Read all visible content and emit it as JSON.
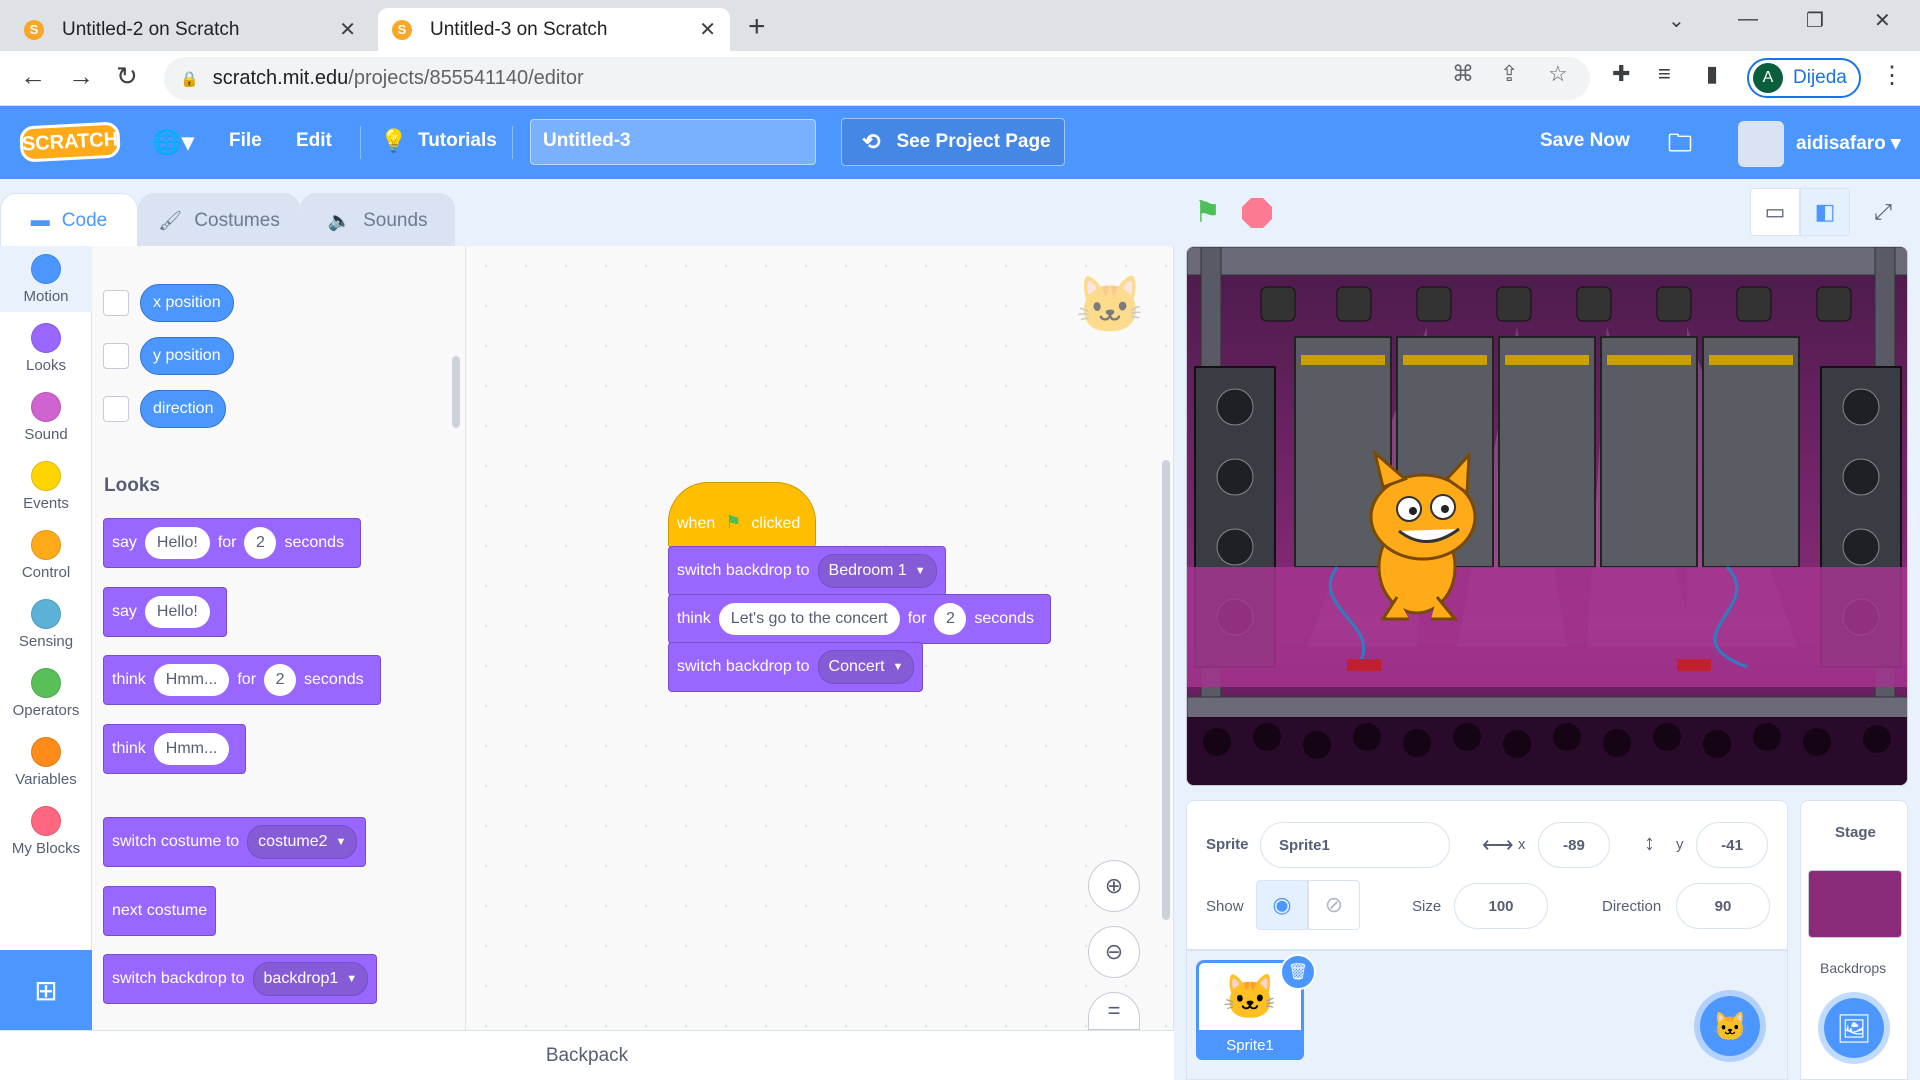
{
  "browser": {
    "tabs": [
      {
        "title": "Untitled-2 on Scratch",
        "active": false
      },
      {
        "title": "Untitled-3 on Scratch",
        "active": true
      }
    ],
    "url_host": "scratch.mit.edu",
    "url_path": "/projects/855541140/editor",
    "profile_initial": "A",
    "profile_name": "Dijeda"
  },
  "menubar": {
    "logo": "SCRATCH",
    "file": "File",
    "edit": "Edit",
    "tutorials": "Tutorials",
    "project_title": "Untitled-3",
    "see_project_page": "See Project Page",
    "save_now": "Save Now",
    "username": "aidisafaro"
  },
  "editor_tabs": {
    "code": "Code",
    "costumes": "Costumes",
    "sounds": "Sounds"
  },
  "categories": [
    {
      "name": "Motion",
      "color": "#4c97ff"
    },
    {
      "name": "Looks",
      "color": "#9966ff"
    },
    {
      "name": "Sound",
      "color": "#cf63cf"
    },
    {
      "name": "Events",
      "color": "#ffd500"
    },
    {
      "name": "Control",
      "color": "#ffab19"
    },
    {
      "name": "Sensing",
      "color": "#5cb1d6"
    },
    {
      "name": "Operators",
      "color": "#59c059"
    },
    {
      "name": "Variables",
      "color": "#ff8c1a"
    },
    {
      "name": "My Blocks",
      "color": "#ff6680"
    }
  ],
  "palette": {
    "motion_reporters": [
      "x position",
      "y position",
      "direction"
    ],
    "looks_heading": "Looks",
    "say_for": {
      "say": "say",
      "text": "Hello!",
      "for": "for",
      "secs": "2",
      "seconds": "seconds"
    },
    "say": {
      "say": "say",
      "text": "Hello!"
    },
    "think_for": {
      "think": "think",
      "text": "Hmm...",
      "for": "for",
      "secs": "2",
      "seconds": "seconds"
    },
    "think": {
      "think": "think",
      "text": "Hmm..."
    },
    "switch_costume": {
      "label": "switch costume to",
      "value": "costume2"
    },
    "next_costume": "next costume",
    "switch_backdrop": {
      "label": "switch backdrop to",
      "value": "backdrop1"
    }
  },
  "script": {
    "hat": {
      "when": "when",
      "clicked": "clicked"
    },
    "block1": {
      "label": "switch backdrop to",
      "value": "Bedroom 1"
    },
    "block2": {
      "think": "think",
      "text": "Let's go to the concert",
      "for": "for",
      "secs": "2",
      "seconds": "seconds"
    },
    "block3": {
      "label": "switch backdrop to",
      "value": "Concert"
    }
  },
  "backpack": "Backpack",
  "sprite_info": {
    "sprite_label": "Sprite",
    "sprite_name": "Sprite1",
    "x_label": "x",
    "x": "-89",
    "y_label": "y",
    "y": "-41",
    "show_label": "Show",
    "size_label": "Size",
    "size": "100",
    "direction_label": "Direction",
    "direction": "90"
  },
  "sprites": [
    {
      "name": "Sprite1"
    }
  ],
  "stage_pane": {
    "title": "Stage",
    "backdrops": "Backdrops"
  }
}
